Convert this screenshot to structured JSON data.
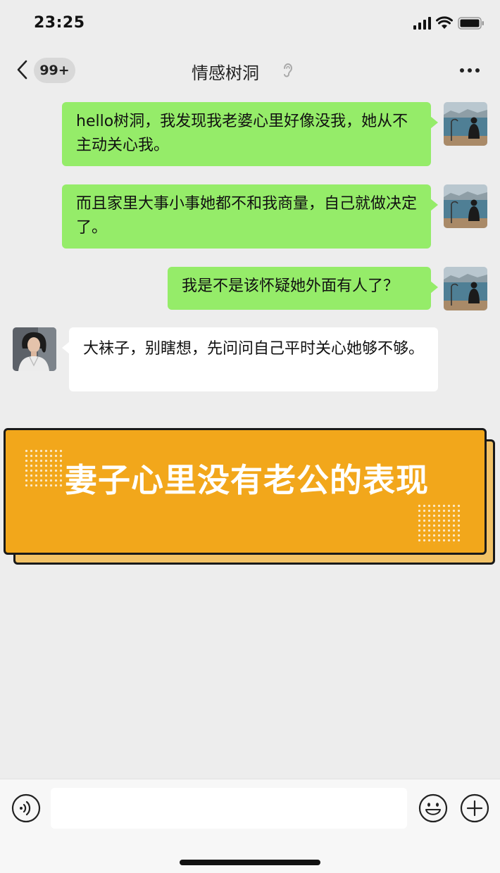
{
  "status_bar": {
    "time": "23:25"
  },
  "nav": {
    "unread_count": "99+",
    "title": "情感树洞"
  },
  "messages": [
    {
      "side": "out",
      "text": "hello树洞，我发现我老婆心里好像没我，她从不主动关心我。"
    },
    {
      "side": "out",
      "text": "而且家里大事小事她都不和我商量，自己就做决定了。"
    },
    {
      "side": "out",
      "text": "我是不是该怀疑她外面有人了？"
    },
    {
      "side": "in",
      "text": "大袜子，别瞎想，先问问自己平时关心她够不够。"
    }
  ],
  "banner": {
    "title": "妻子心里没有老公的表现"
  },
  "input_bar": {
    "placeholder": ""
  },
  "colors": {
    "outgoing_bubble": "#95ec69",
    "incoming_bubble": "#ffffff",
    "banner_front": "#f2a71b",
    "banner_back": "#f2c266",
    "background": "#ededed"
  },
  "icons": [
    "signal-icon",
    "wifi-icon",
    "battery-icon",
    "back-icon",
    "ear-icon",
    "more-icon",
    "voice-icon",
    "emoji-icon",
    "add-icon"
  ]
}
